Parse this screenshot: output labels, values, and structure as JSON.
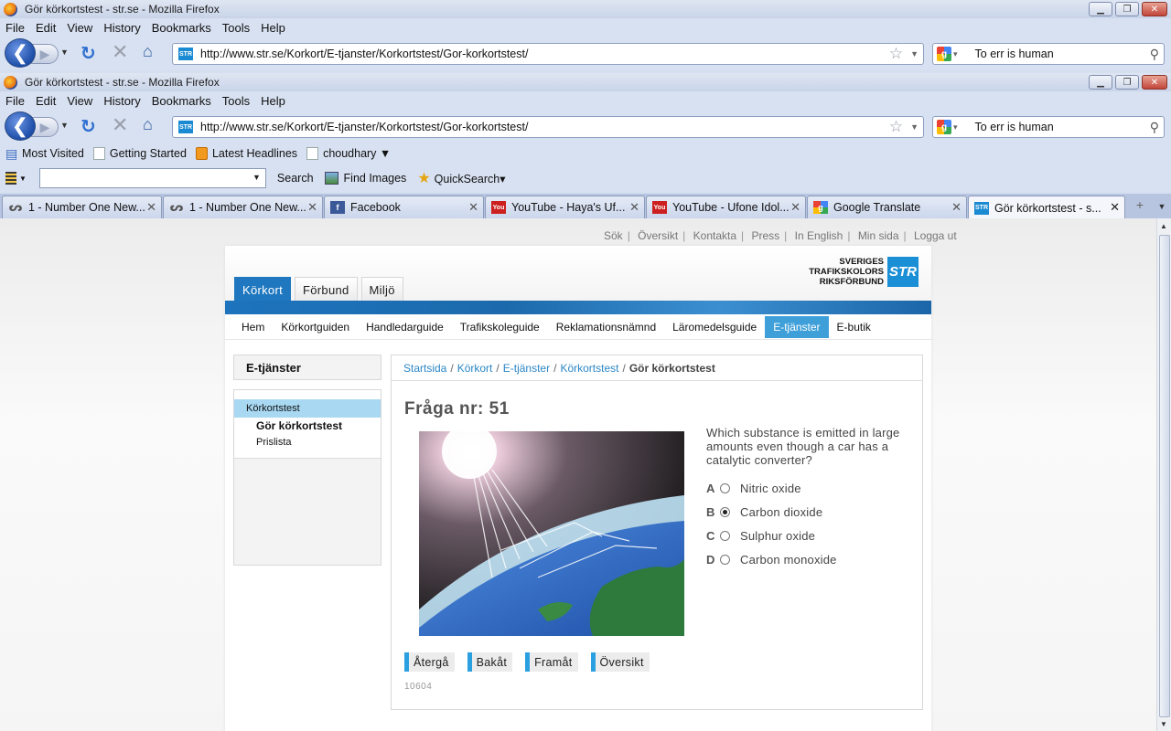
{
  "window": {
    "title": "Gör körkortstest - str.se - Mozilla Firefox"
  },
  "menu": [
    "File",
    "Edit",
    "View",
    "History",
    "Bookmarks",
    "Tools",
    "Help"
  ],
  "nav": {
    "url": "http://www.str.se/Korkort/E-tjanster/Korkortstest/Gor-korkortstest/",
    "site_icon_text": "STR",
    "search_value": "To err is human"
  },
  "bookmarks": [
    {
      "label": "Most Visited",
      "icon": "most-visited-icon"
    },
    {
      "label": "Getting Started",
      "icon": "page-icon"
    },
    {
      "label": "Latest Headlines",
      "icon": "rss-icon"
    },
    {
      "label": "choudhary ▼",
      "icon": "page-icon"
    }
  ],
  "quicksearch": {
    "search": "Search",
    "find_images": "Find Images",
    "quicksearch": "QuickSearch▾"
  },
  "tabs": [
    {
      "title": "1 - Number One New...",
      "icon": "swirl-icon",
      "color": "#555555"
    },
    {
      "title": "1 - Number One New...",
      "icon": "swirl-icon",
      "color": "#555555"
    },
    {
      "title": "Facebook",
      "icon": "facebook-icon",
      "color": "#3b5998"
    },
    {
      "title": "YouTube - Haya's Uf...",
      "icon": "youtube-icon",
      "color": "#cc1f1f"
    },
    {
      "title": "YouTube - Ufone Idol...",
      "icon": "youtube-icon",
      "color": "#cc1f1f"
    },
    {
      "title": "Google Translate",
      "icon": "google-icon",
      "color": "#4285f4"
    },
    {
      "title": "Gör körkortstest - s...",
      "icon": "str-icon",
      "color": "#1a8ad2"
    }
  ],
  "page": {
    "toplinks": [
      "Sök",
      "Översikt",
      "Kontakta",
      "Press",
      "In English",
      "Min sida",
      "Logga ut"
    ],
    "logo": {
      "line1": "SVERIGES",
      "line2": "TRAFIKSKOLORS",
      "line3": "RIKSFÖRBUND",
      "mark": "STR"
    },
    "maintabs": [
      "Körkort",
      "Förbund",
      "Miljö"
    ],
    "subnav": [
      "Hem",
      "Körkortguiden",
      "Handledarguide",
      "Trafikskoleguide",
      "Reklamationsnämnd",
      "Läromedelsguide",
      "E-tjänster",
      "E-butik"
    ],
    "subnav_active": "E-tjänster",
    "sidebar": {
      "title": "E-tjänster",
      "section": "Körkortstest",
      "items": [
        "Gör körkortstest",
        "Prislista"
      ]
    },
    "breadcrumb": [
      "Startsida",
      "Körkort",
      "E-tjänster",
      "Körkortstest"
    ],
    "breadcrumb_current": "Gör körkortstest",
    "question": {
      "title": "Fråga nr: 51",
      "text": "Which substance is emitted in large amounts even though a car has a catalytic converter?",
      "answers": [
        {
          "letter": "A",
          "text": "Nitric oxide",
          "selected": false
        },
        {
          "letter": "B",
          "text": "Carbon dioxide",
          "selected": true
        },
        {
          "letter": "C",
          "text": "Sulphur oxide",
          "selected": false
        },
        {
          "letter": "D",
          "text": "Carbon monoxide",
          "selected": false
        }
      ],
      "buttons": [
        "Återgå",
        "Bakåt",
        "Framåt",
        "Översikt"
      ],
      "id": "10604"
    }
  }
}
